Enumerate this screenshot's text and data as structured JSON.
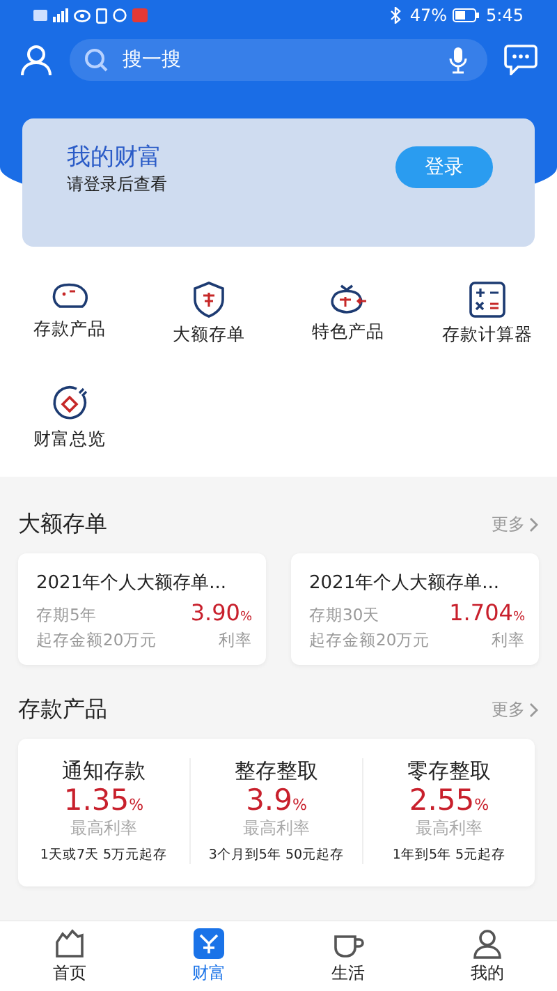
{
  "status_bar": {
    "battery_text": "47%",
    "time": "5:45"
  },
  "header": {
    "search": {
      "placeholder": "搜一搜"
    }
  },
  "wealth_card": {
    "title": "我的财富",
    "subtitle": "请登录后查看",
    "button": "登录"
  },
  "shortcuts": [
    {
      "label": "存款产品",
      "kind": "piggy"
    },
    {
      "label": "大额存单",
      "kind": "shield"
    },
    {
      "label": "特色产品",
      "kind": "bag"
    },
    {
      "label": "存款计算器",
      "kind": "calculator"
    },
    {
      "label": "财富总览",
      "kind": "overview"
    }
  ],
  "cd_section": {
    "title": "大额存单",
    "more": "更多",
    "cards": [
      {
        "name": "2021年个人大额存单...",
        "term": "存期5年",
        "rate": "3.90",
        "unit": "%",
        "minimum": "起存金额20万元",
        "rate_label": "利率"
      },
      {
        "name": "2021年个人大额存单...",
        "term": "存期30天",
        "rate": "1.704",
        "unit": "%",
        "minimum": "起存金额20万元",
        "rate_label": "利率"
      }
    ]
  },
  "deposit_section": {
    "title": "存款产品",
    "more": "更多",
    "products": [
      {
        "name": "通知存款",
        "rate": "1.35",
        "unit": "%",
        "rate_label": "最高利率",
        "terms": "1天或7天  5万元起存"
      },
      {
        "name": "整存整取",
        "rate": "3.9",
        "unit": "%",
        "rate_label": "最高利率",
        "terms": "3个月到5年  50元起存"
      },
      {
        "name": "零存整取",
        "rate": "2.55",
        "unit": "%",
        "rate_label": "最高利率",
        "terms": "1年到5年  5元起存"
      }
    ]
  },
  "tab_bar": [
    {
      "label": "首页",
      "kind": "home",
      "selected": false
    },
    {
      "label": "财富",
      "kind": "wealth",
      "selected": true
    },
    {
      "label": "生活",
      "kind": "life",
      "selected": false
    },
    {
      "label": "我的",
      "kind": "me",
      "selected": false
    }
  ]
}
